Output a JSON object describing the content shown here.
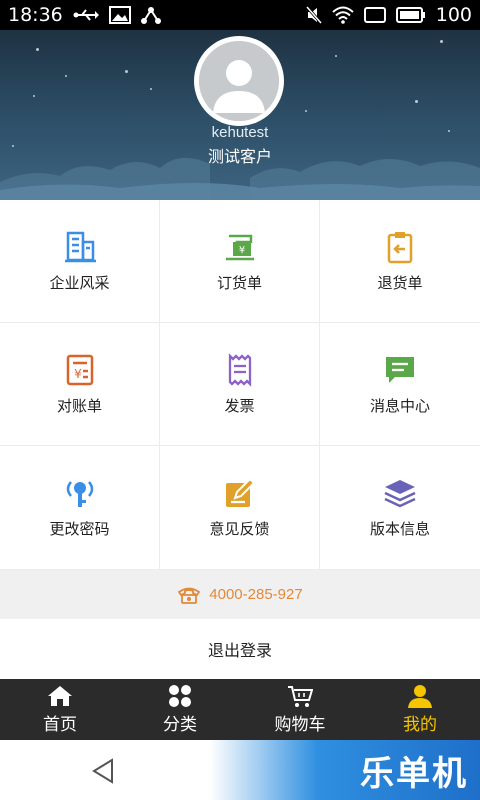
{
  "status_bar": {
    "time": "18:36",
    "battery": "100",
    "icons": [
      "usb-icon",
      "image-icon",
      "share-icon",
      "mute-icon",
      "wifi-icon",
      "sim-icon",
      "battery-icon"
    ]
  },
  "profile": {
    "username": "kehutest",
    "display_name": "测试客户"
  },
  "menu": {
    "items": [
      {
        "label": "企业风采",
        "icon": "building-icon",
        "color": "#3a8ee6"
      },
      {
        "label": "订货单",
        "icon": "order-icon",
        "color": "#5aa84a"
      },
      {
        "label": "退货单",
        "icon": "clipboard-return-icon",
        "color": "#e0a12a"
      },
      {
        "label": "对账单",
        "icon": "statement-icon",
        "color": "#d9642a"
      },
      {
        "label": "发票",
        "icon": "invoice-icon",
        "color": "#8b62c9"
      },
      {
        "label": "消息中心",
        "icon": "message-icon",
        "color": "#5aa84a"
      },
      {
        "label": "更改密码",
        "icon": "key-icon",
        "color": "#3a8ee6"
      },
      {
        "label": "意见反馈",
        "icon": "edit-icon",
        "color": "#e0a12a"
      },
      {
        "label": "版本信息",
        "icon": "layers-icon",
        "color": "#6a62b8"
      }
    ]
  },
  "contact": {
    "phone": "4000-285-927",
    "color": "#e08a3a"
  },
  "logout_label": "退出登录",
  "bottom_nav": {
    "items": [
      {
        "label": "首页",
        "icon": "home-icon"
      },
      {
        "label": "分类",
        "icon": "grid-icon"
      },
      {
        "label": "购物车",
        "icon": "cart-icon"
      },
      {
        "label": "我的",
        "icon": "user-icon"
      }
    ],
    "active_color": "#f5c500"
  },
  "watermark": "乐单机"
}
